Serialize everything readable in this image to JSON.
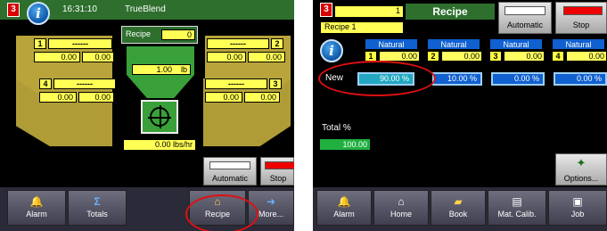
{
  "colors": {
    "hopper": "#b8a43a",
    "alarm_red": "#d80000",
    "accent_green": "#2e6f2e",
    "highlight_oval": "#e01010"
  },
  "left": {
    "alarm_count": "3",
    "time": "16:31:10",
    "title": "TrueBlend",
    "recipe_label": "Recipe",
    "recipe_value": "0",
    "hoppers": [
      {
        "num": "1",
        "name": "------",
        "val1": "0.00",
        "val2": "0.00"
      },
      {
        "num": "2",
        "name": "------",
        "val1": "0.00",
        "val2": "0.00"
      },
      {
        "num": "4",
        "name": "------",
        "val1": "0.00",
        "val2": "0.00"
      },
      {
        "num": "3",
        "name": "------",
        "val1": "0.00",
        "val2": "0.00"
      }
    ],
    "weigh_value": "1.00",
    "weigh_unit": "lb",
    "rate": "0.00 lbs/hr",
    "automatic_label": "Automatic",
    "stop_label": "Stop",
    "nav": [
      {
        "label": "Alarm",
        "icon": "bell-icon"
      },
      {
        "label": "Totals",
        "icon": "sigma-icon"
      },
      {
        "label": "Recipe",
        "icon": "recipe-icon"
      },
      {
        "label": "More...",
        "icon": "arrow-right-icon"
      }
    ]
  },
  "right": {
    "alarm_count": "3",
    "recipe_num": "1",
    "title": "Recipe",
    "recipe_name": "Recipe 1",
    "automatic_label": "Automatic",
    "stop_label": "Stop",
    "columns": [
      {
        "head": "Natural",
        "num": "1",
        "val": "0.00",
        "pct": "90.00 %"
      },
      {
        "head": "Natural",
        "num": "2",
        "val": "0.00",
        "pct": "10.00 %"
      },
      {
        "head": "Natural",
        "num": "3",
        "val": "0.00",
        "pct": "0.00 %"
      },
      {
        "head": "Natural",
        "num": "4",
        "val": "0.00",
        "pct": "0.00 %"
      }
    ],
    "row_label": "New",
    "total_label": "Total %",
    "total_value": "100.00",
    "options_label": "Options...",
    "nav": [
      {
        "label": "Alarm",
        "icon": "bell-icon"
      },
      {
        "label": "Home",
        "icon": "home-icon"
      },
      {
        "label": "Book",
        "icon": "book-icon"
      },
      {
        "label": "Mat. Calib.",
        "icon": "calibration-icon"
      },
      {
        "label": "Job",
        "icon": "job-icon"
      }
    ]
  }
}
